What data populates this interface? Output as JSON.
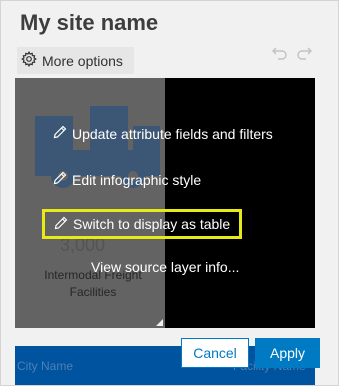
{
  "header": {
    "site_title": "My site name",
    "more_options_label": "More options"
  },
  "background_card": {
    "value": "3,000",
    "caption": "Intermodal Freight Facilities"
  },
  "menu": {
    "items": [
      {
        "label": "Update attribute fields and filters",
        "icon": "pencil-icon"
      },
      {
        "label": "Edit infographic style",
        "icon": "pencil-icon"
      },
      {
        "label": "Switch to display as table",
        "icon": "pencil-icon",
        "highlighted": true
      },
      {
        "label": "View source layer info..."
      }
    ]
  },
  "table_strip": {
    "left_header": "City Name",
    "right_header": "Facility Name"
  },
  "buttons": {
    "cancel_label": "Cancel",
    "apply_label": "Apply"
  },
  "colors": {
    "accent": "#007ac2",
    "highlight": "#e7ea17",
    "strip": "#00539e"
  }
}
